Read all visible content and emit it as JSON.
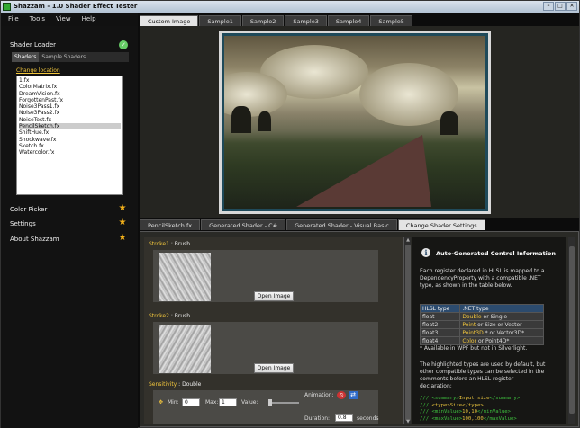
{
  "window": {
    "title": "Shazzam - 1.0 Shader Effect Tester"
  },
  "menu": [
    "File",
    "Tools",
    "View",
    "Help"
  ],
  "sidebar": {
    "shader_loader": "Shader Loader",
    "tabs": [
      "Shaders",
      "Sample Shaders"
    ],
    "change_location": "Change location",
    "files": [
      "1.fx",
      "ColorMatrix.fx",
      "DreamVision.fx",
      "ForgottenPast.fx",
      "Noise3Pass1.fx",
      "Noise3Pass2.fx",
      "NoiseTest.fx",
      "PencilSketch.fx",
      "ShiftHue.fx",
      "Shockwave.fx",
      "Sketch.fx",
      "Watercolor.fx"
    ],
    "selected_file": "PencilSketch.fx",
    "sections": [
      {
        "label": "Color Picker",
        "icon": "star-icon"
      },
      {
        "label": "Settings",
        "icon": "star-icon"
      },
      {
        "label": "About Shazzam",
        "icon": "star-icon"
      }
    ]
  },
  "image_tabs": [
    "Custom Image",
    "Sample1",
    "Sample2",
    "Sample3",
    "Sample4",
    "Sample5"
  ],
  "image_tabs_active": "Custom Image",
  "lower_tabs": [
    "PencilSketch.fx",
    "Generated Shader - C#",
    "Generated Shader - Visual Basic",
    "Change Shader Settings"
  ],
  "lower_tabs_active": "Change Shader Settings",
  "params": {
    "stroke1": {
      "name": "Stroke1",
      "type": " : Brush",
      "button": "Open Image"
    },
    "stroke2": {
      "name": "Stroke2",
      "type": " : Brush",
      "button": "Open Image"
    },
    "sensitivity": {
      "name": "Sensitivity",
      "type": " : Double"
    },
    "min_label": "Min:",
    "min_value": "0",
    "max_label": "Max:",
    "max_value": "1",
    "value_label": "Value:",
    "animation_label": "Animation:",
    "duration_label": "Duration:",
    "duration_value": "0.8",
    "seconds": "seconds"
  },
  "info": {
    "title": "Auto-Generated Control Information",
    "para1": "Each register declared in HLSL is mapped to a DependencyProperty with a compatible .NET type, as shown in the table below.",
    "table_headers": [
      "HLSL type",
      ".NET type"
    ],
    "rows": [
      {
        "hlsl": "float",
        "net_hl": "Double",
        "net_rest": " or Single"
      },
      {
        "hlsl": "float2",
        "net_hl": "Point",
        "net_rest": " or Size or Vector"
      },
      {
        "hlsl": "float3",
        "net_hl": "Point3D",
        "net_rest": " * or Vector3D*"
      },
      {
        "hlsl": "float4",
        "net_hl": "Color",
        "net_rest": " or Point4D*"
      }
    ],
    "footnote": "* Available in WPF but not in Silverlight.",
    "para2": "The highlighted types are used by default, but other compatible types can be selected in the comments before an HLSL register declaration:",
    "code": [
      {
        "a": "/// <summary>",
        "b": "Input size",
        "c": "</summary>"
      },
      {
        "a": "/// ",
        "b": "<type>Size</type>",
        "c": ""
      },
      {
        "a": "/// <minValue>",
        "b": "10,10",
        "c": "</minValue>"
      },
      {
        "a": "/// <maxValue>",
        "b": "100,100",
        "c": "</maxValue>"
      }
    ]
  }
}
